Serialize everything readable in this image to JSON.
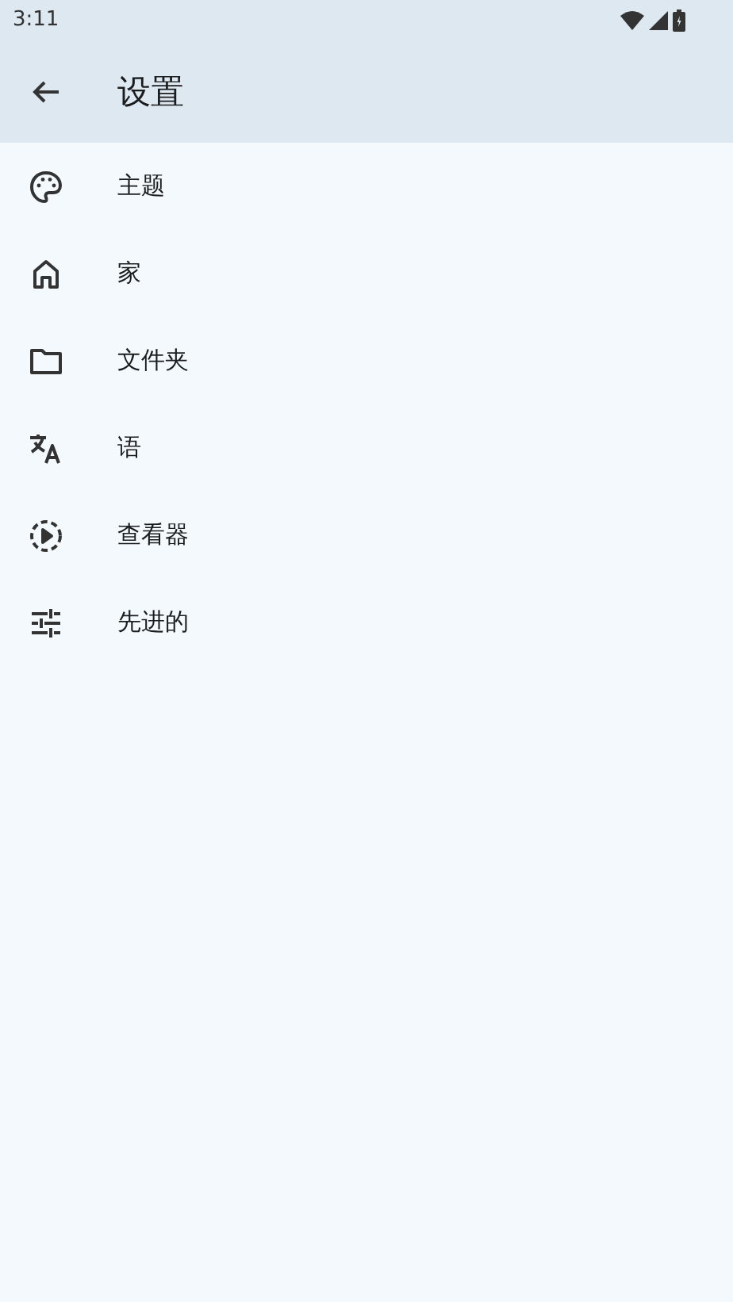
{
  "status_bar": {
    "time": "3:11"
  },
  "app_bar": {
    "title": "设置"
  },
  "items": [
    {
      "kind": "palette",
      "label": "主题"
    },
    {
      "kind": "home",
      "label": "家"
    },
    {
      "kind": "folder",
      "label": "文件夹"
    },
    {
      "kind": "translate",
      "label": "语"
    },
    {
      "kind": "viewer",
      "label": "查看器"
    },
    {
      "kind": "tune",
      "label": "先进的"
    }
  ]
}
